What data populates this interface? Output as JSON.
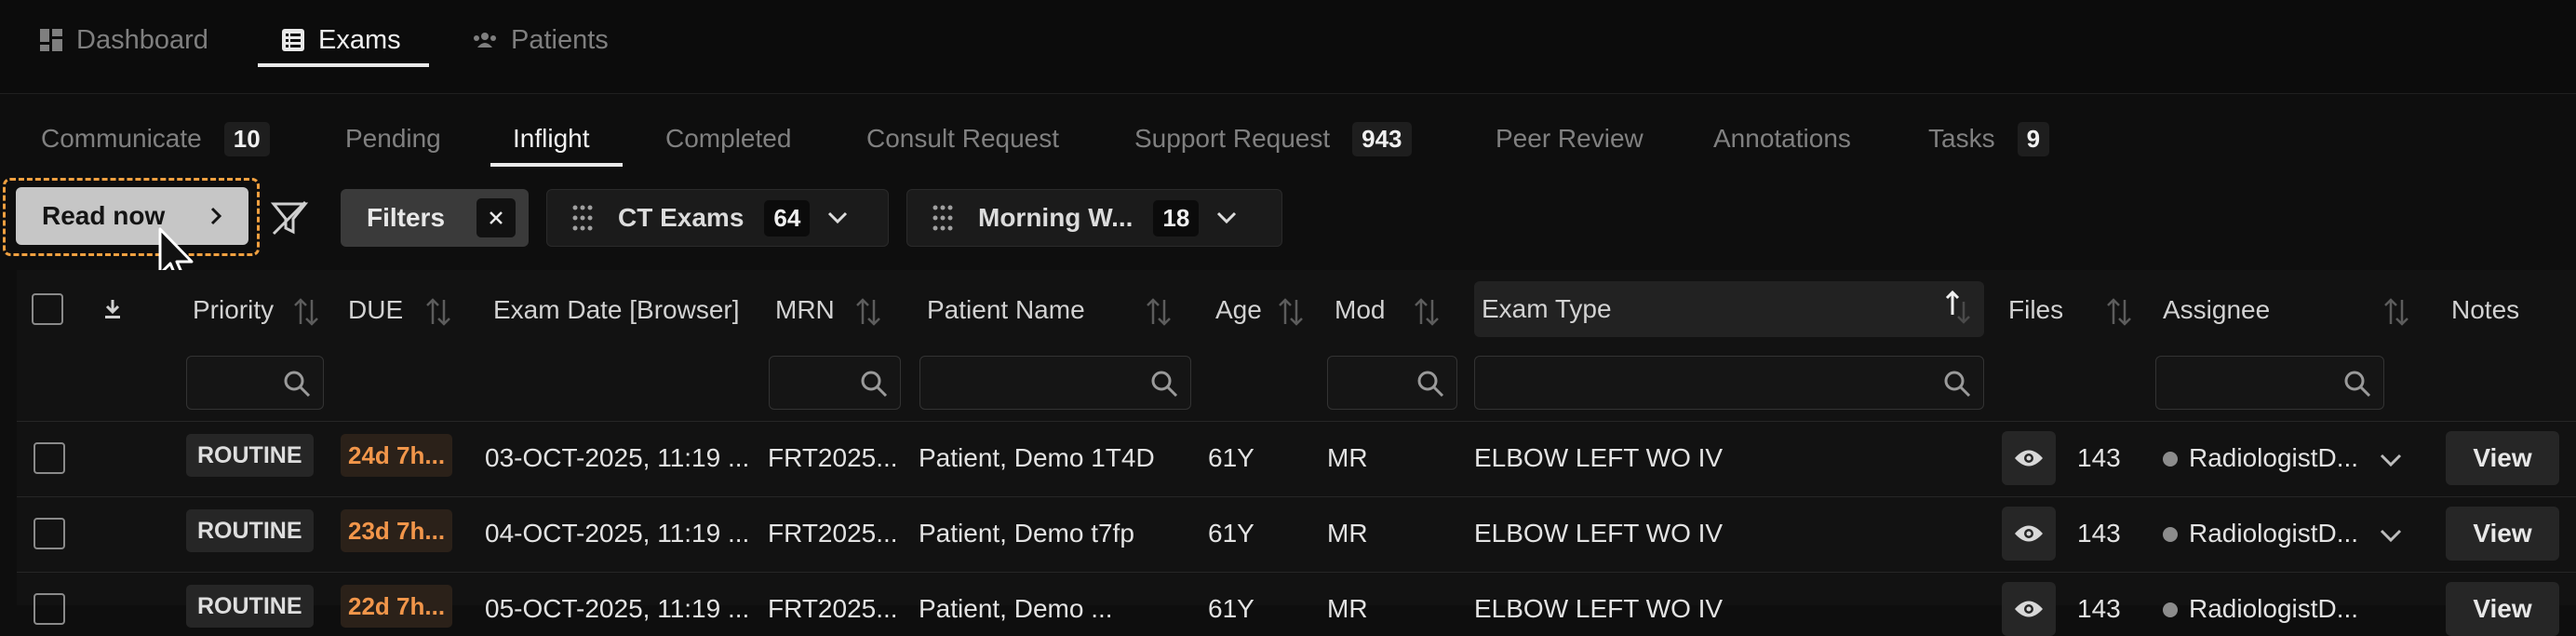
{
  "topnav": {
    "items": [
      {
        "label": "Dashboard",
        "icon": "dashboard-icon"
      },
      {
        "label": "Exams",
        "icon": "list-icon"
      },
      {
        "label": "Patients",
        "icon": "users-icon"
      }
    ],
    "active": "Exams"
  },
  "subtabs": [
    {
      "label": "Communicate",
      "count": "10"
    },
    {
      "label": "Pending",
      "count": ""
    },
    {
      "label": "Inflight",
      "count": ""
    },
    {
      "label": "Completed",
      "count": ""
    },
    {
      "label": "Consult Request",
      "count": ""
    },
    {
      "label": "Support Request",
      "count": "943"
    },
    {
      "label": "Peer Review",
      "count": ""
    },
    {
      "label": "Annotations",
      "count": ""
    },
    {
      "label": "Tasks",
      "count": "9"
    }
  ],
  "active_subtab": "Inflight",
  "toolbar": {
    "read_now_label": "Read now",
    "filters_label": "Filters",
    "presets": [
      {
        "label": "CT Exams",
        "count": "64"
      },
      {
        "label": "Morning W...",
        "count": "18"
      }
    ]
  },
  "table": {
    "headers": {
      "priority": "Priority",
      "due": "DUE",
      "exam_date": "Exam Date [Browser]",
      "mrn": "MRN",
      "patient_name": "Patient Name",
      "age": "Age",
      "mod": "Mod",
      "exam_type": "Exam Type",
      "files": "Files",
      "assignee": "Assignee",
      "notes": "Notes"
    },
    "sorted_column": "Exam Type",
    "rows": [
      {
        "priority": "ROUTINE",
        "due": "24d 7h...",
        "exam_date": "03-OCT-2025, 11:19 ...",
        "mrn": "FRT2025...",
        "patient_name": "Patient, Demo 1T4D",
        "age": "61Y",
        "mod": "MR",
        "exam_type": "ELBOW LEFT WO IV",
        "files": "143",
        "assignee": "RadiologistD...",
        "notes_action": "View"
      },
      {
        "priority": "ROUTINE",
        "due": "23d 7h...",
        "exam_date": "04-OCT-2025, 11:19 ...",
        "mrn": "FRT2025...",
        "patient_name": "Patient, Demo t7fp",
        "age": "61Y",
        "mod": "MR",
        "exam_type": "ELBOW LEFT WO IV",
        "files": "143",
        "assignee": "RadiologistD...",
        "notes_action": "View"
      },
      {
        "priority": "ROUTINE",
        "due": "22d 7h...",
        "exam_date": "05-OCT-2025, 11:19 ...",
        "mrn": "FRT2025...",
        "patient_name": "Patient, Demo ...",
        "age": "61Y",
        "mod": "MR",
        "exam_type": "ELBOW LEFT WO IV",
        "files": "143",
        "assignee": "RadiologistD...",
        "notes_action": "View"
      }
    ]
  },
  "colors": {
    "background": "#0e0e0e",
    "due_orange": "#f2964a",
    "focus_dashed": "#f0a040"
  }
}
